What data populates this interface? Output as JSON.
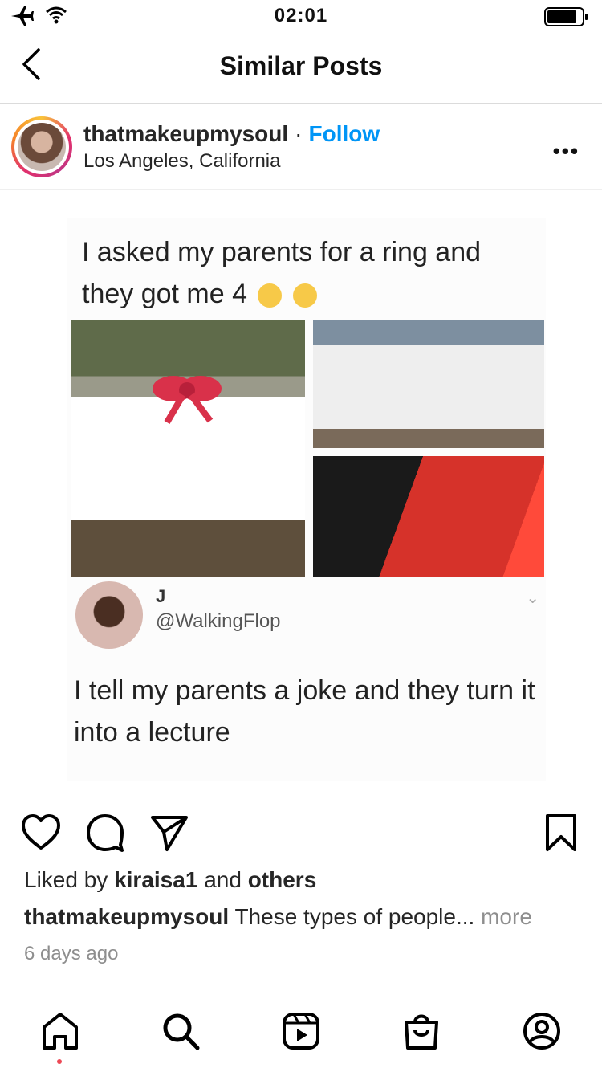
{
  "status_bar": {
    "time": "02:01"
  },
  "header": {
    "title": "Similar Posts"
  },
  "post": {
    "username": "thatmakeupmysoul",
    "separator": "·",
    "follow_label": "Follow",
    "location": "Los Angeles, California",
    "more_label": "•••"
  },
  "meme": {
    "top_text": "I asked my parents for a ring and they got me 4",
    "tweet_name": "J",
    "tweet_handle": "@WalkingFlop",
    "bottom_text": "I tell my parents a joke and they turn it into a lecture"
  },
  "likes": {
    "prefix": "Liked by",
    "user": "kiraisa1",
    "middle": "and",
    "others": "others"
  },
  "caption": {
    "username": "thatmakeupmysoul",
    "text": "These types of people...",
    "more": "more"
  },
  "timestamp": "6 days ago",
  "colors": {
    "follow_blue": "#0095f6",
    "notification_red": "#ed4956",
    "muted_gray": "#8e8e8e"
  }
}
